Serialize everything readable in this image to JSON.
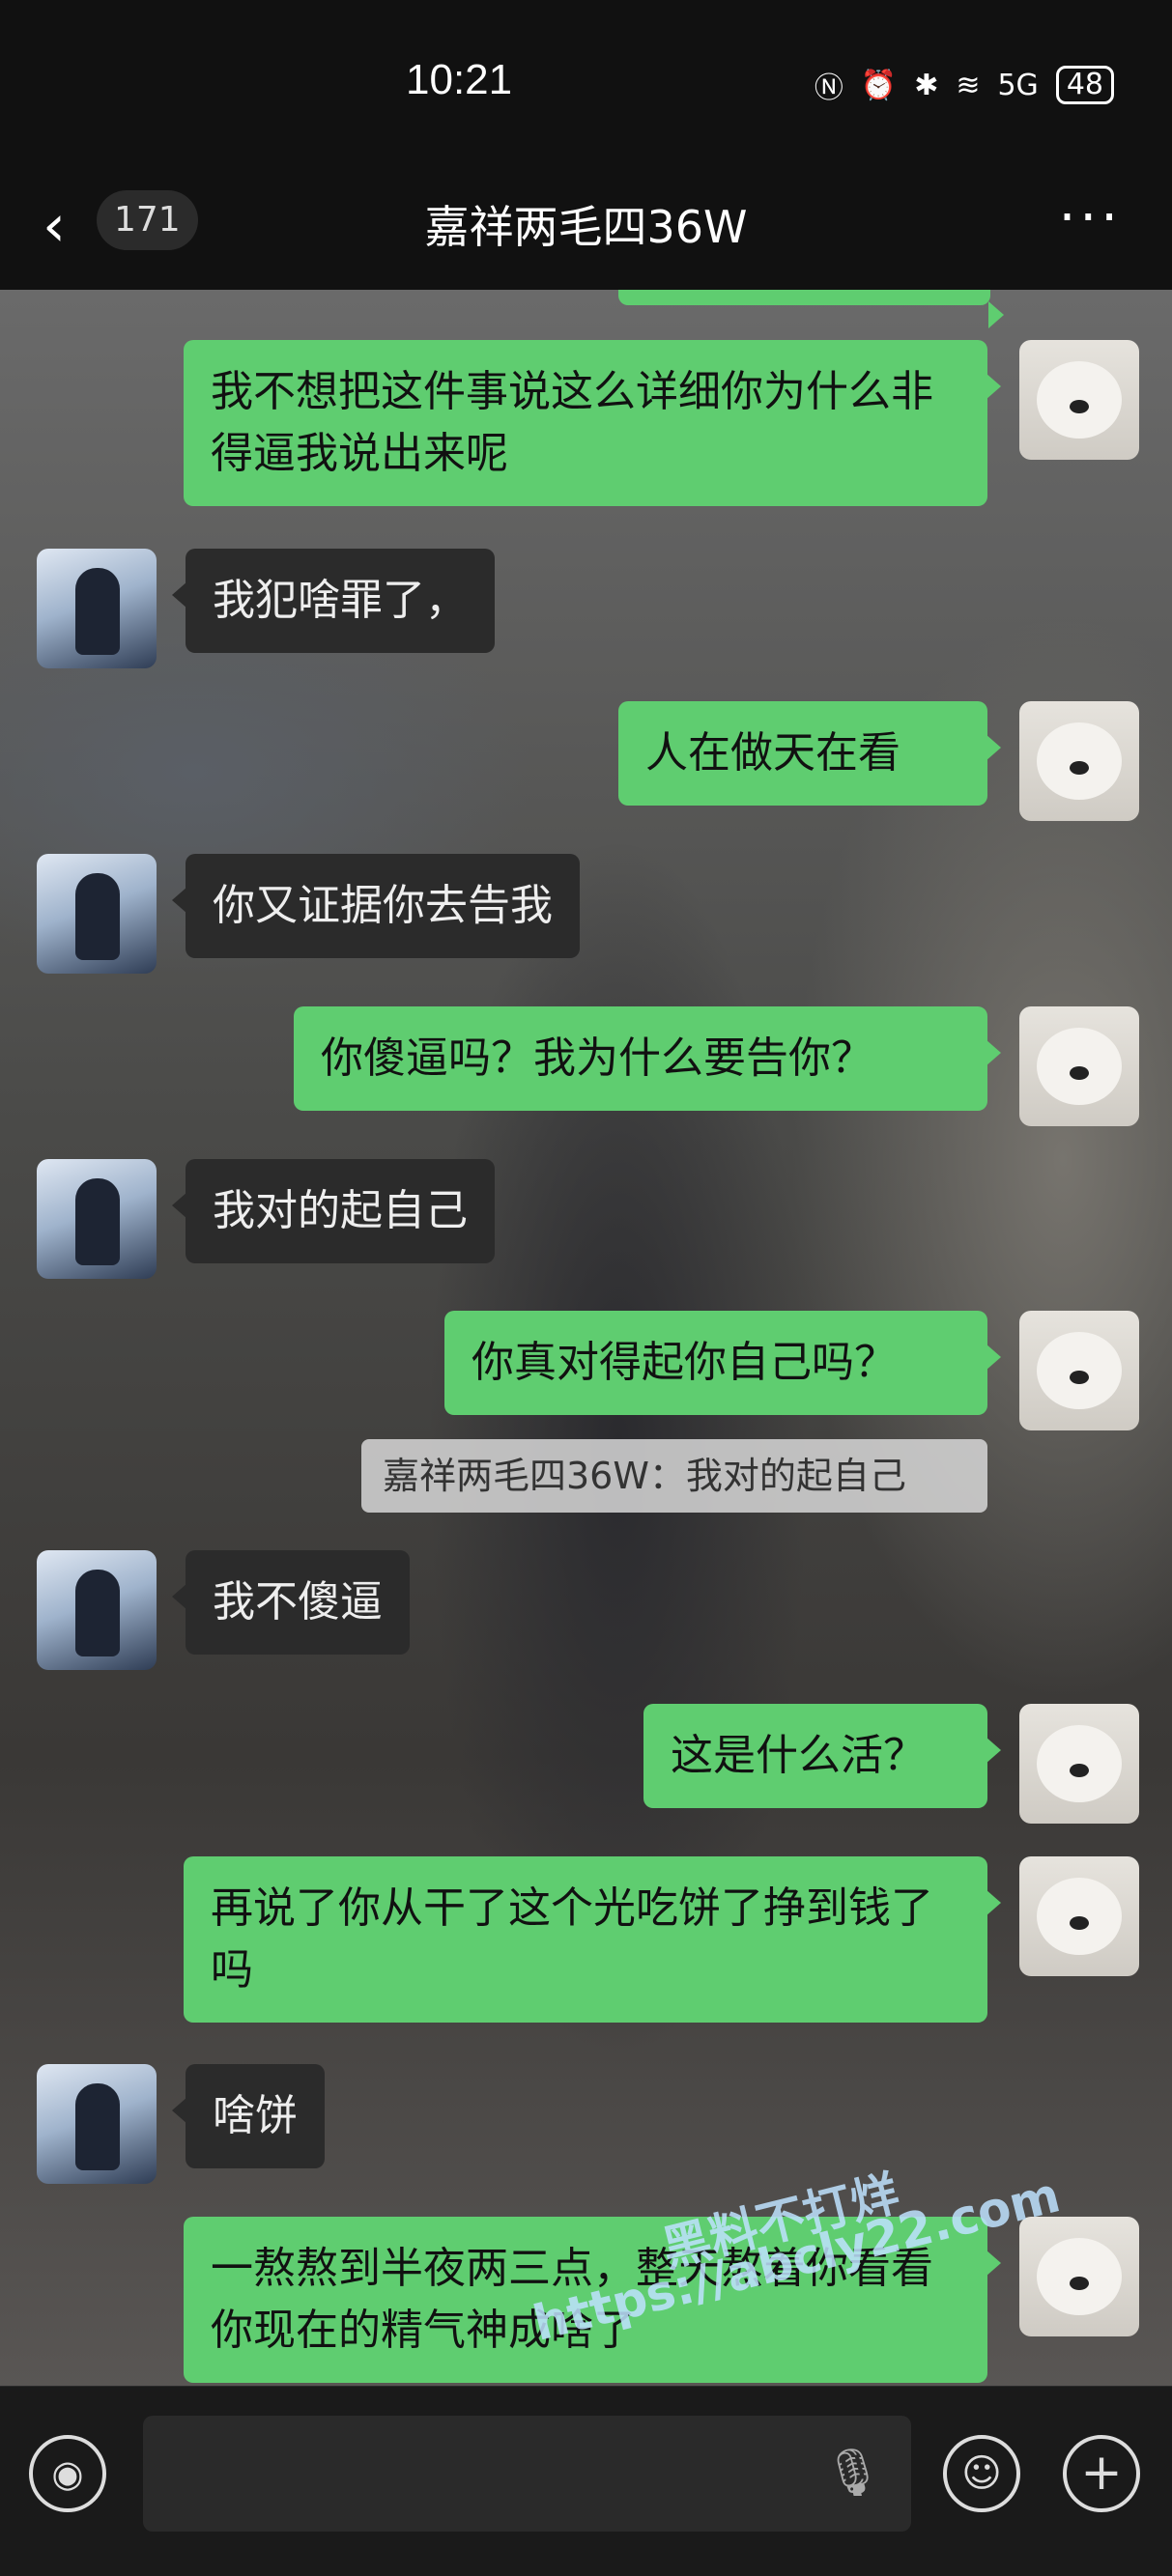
{
  "status_bar": {
    "time": "10:21",
    "icons": [
      "nfc-icon",
      "alarm-icon",
      "bluetooth-icon",
      "wifi-icon",
      "signal-5g-icon"
    ],
    "signal_label": "5G",
    "battery": "48"
  },
  "header": {
    "back_glyph": "‹",
    "unread_count": "171",
    "title": "嘉祥两毛四36W",
    "more_glyph": "···"
  },
  "messages": [
    {
      "side": "right",
      "text": "我不想把这件事说这么详细你为什么非得逼我说出来呢"
    },
    {
      "side": "left",
      "text": "我犯啥罪了，"
    },
    {
      "side": "right",
      "text": "人在做天在看"
    },
    {
      "side": "left",
      "text": "你又证据你去告我"
    },
    {
      "side": "right",
      "text": "你傻逼吗？我为什么要告你？"
    },
    {
      "side": "left",
      "text": "我对的起自己"
    },
    {
      "side": "right",
      "text": "你真对得起你自己吗？"
    },
    {
      "side": "left",
      "text": "我不傻逼"
    },
    {
      "side": "right",
      "text": "这是什么活？"
    },
    {
      "side": "right",
      "text": "再说了你从干了这个光吃饼了挣到钱了吗"
    },
    {
      "side": "left",
      "text": "啥饼"
    },
    {
      "side": "right",
      "text": "一熬熬到半夜两三点，整天熬着你看看你现在的精气神成啥了"
    }
  ],
  "quote": "嘉祥两毛四36W：我对的起自己",
  "watermark": {
    "line1": "黑料不打烊",
    "line2": "https://abcly22.com"
  },
  "input_bar": {
    "voice_icon": "voice-icon",
    "mic_icon": "microphone-icon",
    "emoji_icon": "emoji-icon",
    "plus_icon": "plus-icon"
  }
}
